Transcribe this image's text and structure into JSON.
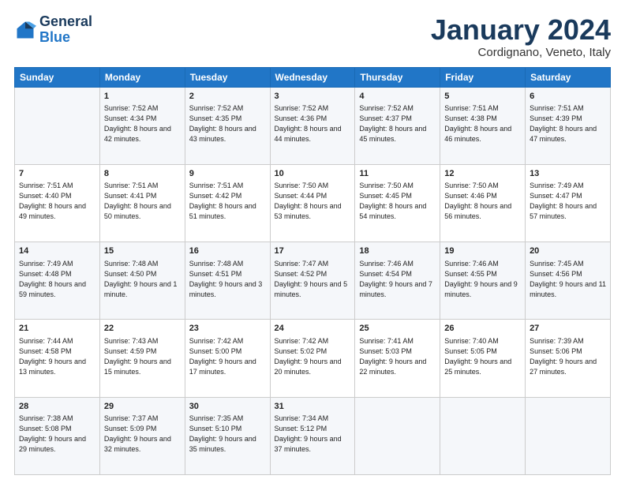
{
  "logo": {
    "line1": "General",
    "line2": "Blue"
  },
  "header": {
    "title": "January 2024",
    "subtitle": "Cordignano, Veneto, Italy"
  },
  "days_of_week": [
    "Sunday",
    "Monday",
    "Tuesday",
    "Wednesday",
    "Thursday",
    "Friday",
    "Saturday"
  ],
  "weeks": [
    [
      {
        "day": "",
        "sunrise": "",
        "sunset": "",
        "daylight": ""
      },
      {
        "day": "1",
        "sunrise": "Sunrise: 7:52 AM",
        "sunset": "Sunset: 4:34 PM",
        "daylight": "Daylight: 8 hours and 42 minutes."
      },
      {
        "day": "2",
        "sunrise": "Sunrise: 7:52 AM",
        "sunset": "Sunset: 4:35 PM",
        "daylight": "Daylight: 8 hours and 43 minutes."
      },
      {
        "day": "3",
        "sunrise": "Sunrise: 7:52 AM",
        "sunset": "Sunset: 4:36 PM",
        "daylight": "Daylight: 8 hours and 44 minutes."
      },
      {
        "day": "4",
        "sunrise": "Sunrise: 7:52 AM",
        "sunset": "Sunset: 4:37 PM",
        "daylight": "Daylight: 8 hours and 45 minutes."
      },
      {
        "day": "5",
        "sunrise": "Sunrise: 7:51 AM",
        "sunset": "Sunset: 4:38 PM",
        "daylight": "Daylight: 8 hours and 46 minutes."
      },
      {
        "day": "6",
        "sunrise": "Sunrise: 7:51 AM",
        "sunset": "Sunset: 4:39 PM",
        "daylight": "Daylight: 8 hours and 47 minutes."
      }
    ],
    [
      {
        "day": "7",
        "sunrise": "Sunrise: 7:51 AM",
        "sunset": "Sunset: 4:40 PM",
        "daylight": "Daylight: 8 hours and 49 minutes."
      },
      {
        "day": "8",
        "sunrise": "Sunrise: 7:51 AM",
        "sunset": "Sunset: 4:41 PM",
        "daylight": "Daylight: 8 hours and 50 minutes."
      },
      {
        "day": "9",
        "sunrise": "Sunrise: 7:51 AM",
        "sunset": "Sunset: 4:42 PM",
        "daylight": "Daylight: 8 hours and 51 minutes."
      },
      {
        "day": "10",
        "sunrise": "Sunrise: 7:50 AM",
        "sunset": "Sunset: 4:44 PM",
        "daylight": "Daylight: 8 hours and 53 minutes."
      },
      {
        "day": "11",
        "sunrise": "Sunrise: 7:50 AM",
        "sunset": "Sunset: 4:45 PM",
        "daylight": "Daylight: 8 hours and 54 minutes."
      },
      {
        "day": "12",
        "sunrise": "Sunrise: 7:50 AM",
        "sunset": "Sunset: 4:46 PM",
        "daylight": "Daylight: 8 hours and 56 minutes."
      },
      {
        "day": "13",
        "sunrise": "Sunrise: 7:49 AM",
        "sunset": "Sunset: 4:47 PM",
        "daylight": "Daylight: 8 hours and 57 minutes."
      }
    ],
    [
      {
        "day": "14",
        "sunrise": "Sunrise: 7:49 AM",
        "sunset": "Sunset: 4:48 PM",
        "daylight": "Daylight: 8 hours and 59 minutes."
      },
      {
        "day": "15",
        "sunrise": "Sunrise: 7:48 AM",
        "sunset": "Sunset: 4:50 PM",
        "daylight": "Daylight: 9 hours and 1 minute."
      },
      {
        "day": "16",
        "sunrise": "Sunrise: 7:48 AM",
        "sunset": "Sunset: 4:51 PM",
        "daylight": "Daylight: 9 hours and 3 minutes."
      },
      {
        "day": "17",
        "sunrise": "Sunrise: 7:47 AM",
        "sunset": "Sunset: 4:52 PM",
        "daylight": "Daylight: 9 hours and 5 minutes."
      },
      {
        "day": "18",
        "sunrise": "Sunrise: 7:46 AM",
        "sunset": "Sunset: 4:54 PM",
        "daylight": "Daylight: 9 hours and 7 minutes."
      },
      {
        "day": "19",
        "sunrise": "Sunrise: 7:46 AM",
        "sunset": "Sunset: 4:55 PM",
        "daylight": "Daylight: 9 hours and 9 minutes."
      },
      {
        "day": "20",
        "sunrise": "Sunrise: 7:45 AM",
        "sunset": "Sunset: 4:56 PM",
        "daylight": "Daylight: 9 hours and 11 minutes."
      }
    ],
    [
      {
        "day": "21",
        "sunrise": "Sunrise: 7:44 AM",
        "sunset": "Sunset: 4:58 PM",
        "daylight": "Daylight: 9 hours and 13 minutes."
      },
      {
        "day": "22",
        "sunrise": "Sunrise: 7:43 AM",
        "sunset": "Sunset: 4:59 PM",
        "daylight": "Daylight: 9 hours and 15 minutes."
      },
      {
        "day": "23",
        "sunrise": "Sunrise: 7:42 AM",
        "sunset": "Sunset: 5:00 PM",
        "daylight": "Daylight: 9 hours and 17 minutes."
      },
      {
        "day": "24",
        "sunrise": "Sunrise: 7:42 AM",
        "sunset": "Sunset: 5:02 PM",
        "daylight": "Daylight: 9 hours and 20 minutes."
      },
      {
        "day": "25",
        "sunrise": "Sunrise: 7:41 AM",
        "sunset": "Sunset: 5:03 PM",
        "daylight": "Daylight: 9 hours and 22 minutes."
      },
      {
        "day": "26",
        "sunrise": "Sunrise: 7:40 AM",
        "sunset": "Sunset: 5:05 PM",
        "daylight": "Daylight: 9 hours and 25 minutes."
      },
      {
        "day": "27",
        "sunrise": "Sunrise: 7:39 AM",
        "sunset": "Sunset: 5:06 PM",
        "daylight": "Daylight: 9 hours and 27 minutes."
      }
    ],
    [
      {
        "day": "28",
        "sunrise": "Sunrise: 7:38 AM",
        "sunset": "Sunset: 5:08 PM",
        "daylight": "Daylight: 9 hours and 29 minutes."
      },
      {
        "day": "29",
        "sunrise": "Sunrise: 7:37 AM",
        "sunset": "Sunset: 5:09 PM",
        "daylight": "Daylight: 9 hours and 32 minutes."
      },
      {
        "day": "30",
        "sunrise": "Sunrise: 7:35 AM",
        "sunset": "Sunset: 5:10 PM",
        "daylight": "Daylight: 9 hours and 35 minutes."
      },
      {
        "day": "31",
        "sunrise": "Sunrise: 7:34 AM",
        "sunset": "Sunset: 5:12 PM",
        "daylight": "Daylight: 9 hours and 37 minutes."
      },
      {
        "day": "",
        "sunrise": "",
        "sunset": "",
        "daylight": ""
      },
      {
        "day": "",
        "sunrise": "",
        "sunset": "",
        "daylight": ""
      },
      {
        "day": "",
        "sunrise": "",
        "sunset": "",
        "daylight": ""
      }
    ]
  ]
}
